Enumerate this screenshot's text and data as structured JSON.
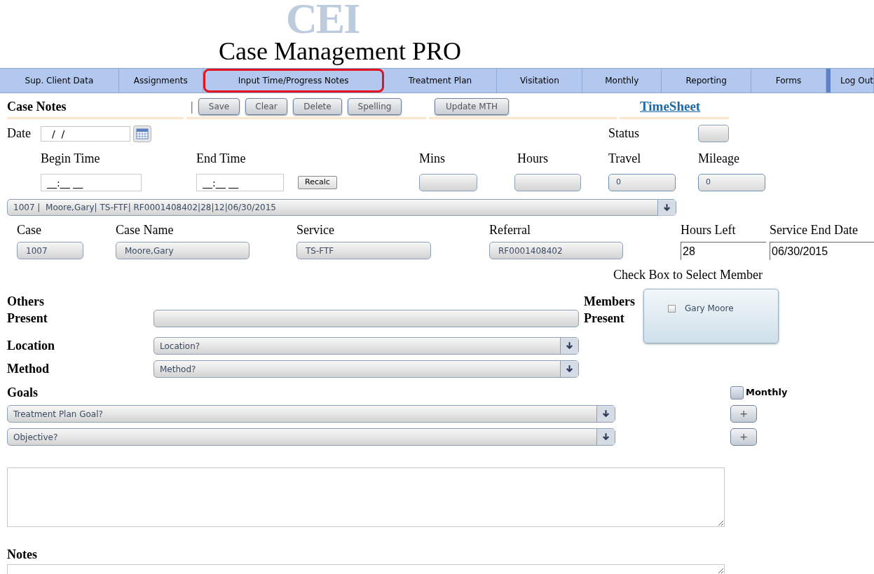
{
  "logo": {
    "watermark": "CEI",
    "title": "Case Management PRO"
  },
  "nav": [
    {
      "label": "Sup. Client Data",
      "selected": false
    },
    {
      "label": "Assignments",
      "selected": false
    },
    {
      "label": "Input Time/Progress Notes",
      "selected": true
    },
    {
      "label": "Treatment Plan",
      "selected": false
    },
    {
      "label": "Visitation",
      "selected": false
    },
    {
      "label": "Monthly",
      "selected": false
    },
    {
      "label": "Reporting",
      "selected": false
    },
    {
      "label": "Forms",
      "selected": false
    },
    {
      "label": "Log Out",
      "selected": false
    }
  ],
  "toolbar": {
    "title": "Case Notes",
    "separator": "|",
    "buttons": [
      "Save",
      "Clear",
      "Delete",
      "Spelling"
    ],
    "update_button": "Update MTH",
    "timesheet_link": "TimeSheet"
  },
  "date": {
    "label": "Date",
    "value": "  /  /"
  },
  "status": {
    "label": "Status"
  },
  "time": {
    "begin_label": "Begin Time",
    "begin_value": "__:__ __",
    "end_label": "End Time",
    "end_value": "__:__ __",
    "recalc_button": "Recalc",
    "mins_label": "Mins",
    "hours_label": "Hours",
    "travel_label": "Travel",
    "travel_value": "0",
    "mileage_label": "Mileage",
    "mileage_value": "0"
  },
  "case_select": "1007 |  Moore,Gary| TS-FTF| RF0001408402|28|12|06/30/2015",
  "case_fields": [
    {
      "label": "Case",
      "value": "1007"
    },
    {
      "label": "Case Name",
      "value": "Moore,Gary"
    },
    {
      "label": "Service",
      "value": "TS-FTF"
    },
    {
      "label": "Referral",
      "value": "RF0001408402"
    },
    {
      "label": "Hours Left",
      "value": "28"
    },
    {
      "label": "Service End Date",
      "value": "06/30/2015"
    }
  ],
  "members": {
    "hint": "Check Box to Select Member",
    "label": "Members Present",
    "items": [
      {
        "name": "Gary Moore",
        "checked": false
      }
    ]
  },
  "others_present": {
    "label": "Others Present"
  },
  "location": {
    "label": "Location",
    "placeholder": "Location?"
  },
  "method": {
    "label": "Method",
    "placeholder": "Method?"
  },
  "goals": {
    "label": "Goals",
    "monthly": {
      "label": "Monthly",
      "checked": false
    },
    "goal_placeholder": "Treatment Plan Goal?",
    "objective_placeholder": "Objective?",
    "add_buttons": [
      "+",
      "+"
    ]
  },
  "notes": {
    "label": "Notes"
  }
}
